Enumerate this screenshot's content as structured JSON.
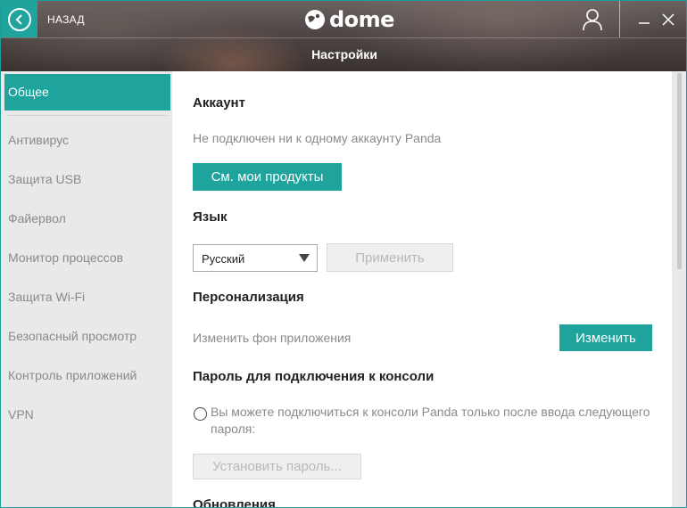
{
  "header": {
    "back_label": "НАЗАД",
    "logo_text": "dome",
    "title": "Настройки"
  },
  "sidebar": {
    "items": [
      {
        "label": "Общее",
        "active": true
      },
      {
        "label": "Антивирус"
      },
      {
        "label": "Защита USB"
      },
      {
        "label": "Файервол"
      },
      {
        "label": "Монитор процессов"
      },
      {
        "label": "Защита Wi-Fi"
      },
      {
        "label": "Безопасный просмотр"
      },
      {
        "label": "Контроль приложений"
      },
      {
        "label": "VPN"
      }
    ]
  },
  "account": {
    "heading": "Аккаунт",
    "status": "Не подключен ни к одному аккаунту Panda",
    "products_button": "См. мои продукты"
  },
  "language": {
    "heading": "Язык",
    "selected": "Русский",
    "apply_button": "Применить"
  },
  "personalization": {
    "heading": "Персонализация",
    "description": "Изменить фон приложения",
    "change_button": "Изменить"
  },
  "console_password": {
    "heading": "Пароль для подключения к консоли",
    "option_text": "Вы можете подключиться к консоли Panda только после ввода следующего пароля:",
    "set_button": "Установить пароль..."
  },
  "updates": {
    "heading": "Обновления"
  },
  "colors": {
    "accent": "#1ea39d",
    "sidebar_bg": "#e9e9e9",
    "muted_text": "#8a8a8a"
  }
}
